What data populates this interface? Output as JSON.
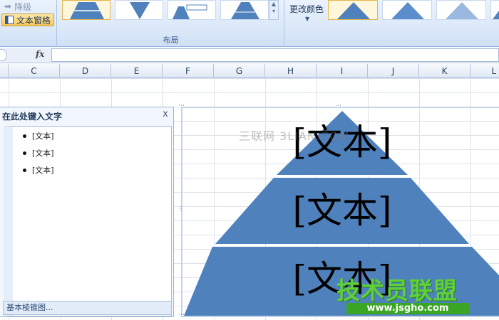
{
  "ribbon": {
    "demote_label": "降级",
    "text_pane_label": "文本窗格",
    "layout_group_label": "布局",
    "change_colors_label": "更改颜色",
    "colors": {
      "accent": "#4f81bd",
      "selected_border": "#e3b54a"
    }
  },
  "formula_bar": {
    "fx_label": "fx",
    "value": ""
  },
  "columns": [
    "C",
    "D",
    "E",
    "F",
    "G",
    "H",
    "I",
    "J",
    "K",
    "L"
  ],
  "text_pane": {
    "title": "在此处键入文字",
    "close_label": "x",
    "items": [
      "[文本]",
      "[文本]",
      "[文本]"
    ],
    "footer": "基本棱锥图..."
  },
  "smartart": {
    "levels": [
      "[文本]",
      "[文本]",
      "[文本]"
    ],
    "fill_color": "#4f81bd"
  },
  "watermarks": {
    "site_text": "三联网 3LIAN.COM",
    "logo_text": "技术员联盟",
    "logo_url": "www.jsgho.com"
  }
}
